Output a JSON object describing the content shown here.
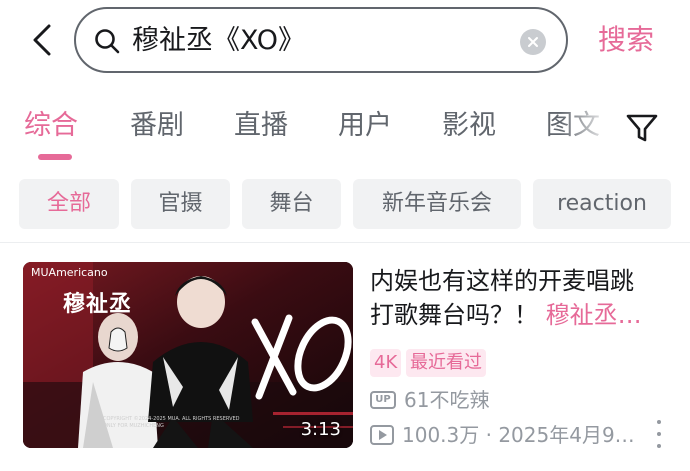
{
  "search": {
    "query": "穆祉丞《XO》",
    "button_label": "搜索"
  },
  "tabs": [
    {
      "label": "综合",
      "active": true
    },
    {
      "label": "番剧",
      "active": false
    },
    {
      "label": "直播",
      "active": false
    },
    {
      "label": "用户",
      "active": false
    },
    {
      "label": "影视",
      "active": false
    },
    {
      "label": "图文",
      "active": false
    }
  ],
  "chips": [
    {
      "label": "全部",
      "active": true
    },
    {
      "label": "官摄",
      "active": false
    },
    {
      "label": "舞台",
      "active": false
    },
    {
      "label": "新年音乐会",
      "active": false
    },
    {
      "label": "reaction",
      "active": false
    }
  ],
  "result": {
    "thumbnail": {
      "channel": "MUAmericano",
      "name_overlay": "穆祉丞",
      "title_overlay": "XO",
      "copyright": "COPYRIGHT ©2024-2025 MUA. ALL RIGHTS RESERVED ONLY FOR MUZHICHENG",
      "duration": "3:13"
    },
    "title_line1": "内娱也有这样的开麦唱跳",
    "title_line2_prefix": "打歌舞台吗？！ ",
    "title_line2_highlight": "穆祉丞…",
    "badges": [
      "4K",
      "最近看过"
    ],
    "uploader": "61不吃辣",
    "stats": "100.3万 · 2025年4月9…",
    "up_icon_label": "UP"
  },
  "colors": {
    "accent": "#e66a98",
    "text_primary": "#18191c",
    "text_secondary": "#61666d",
    "text_meta": "#9499a0",
    "chip_bg": "#f1f2f3",
    "badge_bg": "#fde8f0"
  },
  "icons": [
    "back-arrow-icon",
    "search-icon",
    "clear-icon",
    "filter-icon",
    "up-icon",
    "play-count-icon",
    "more-icon"
  ]
}
